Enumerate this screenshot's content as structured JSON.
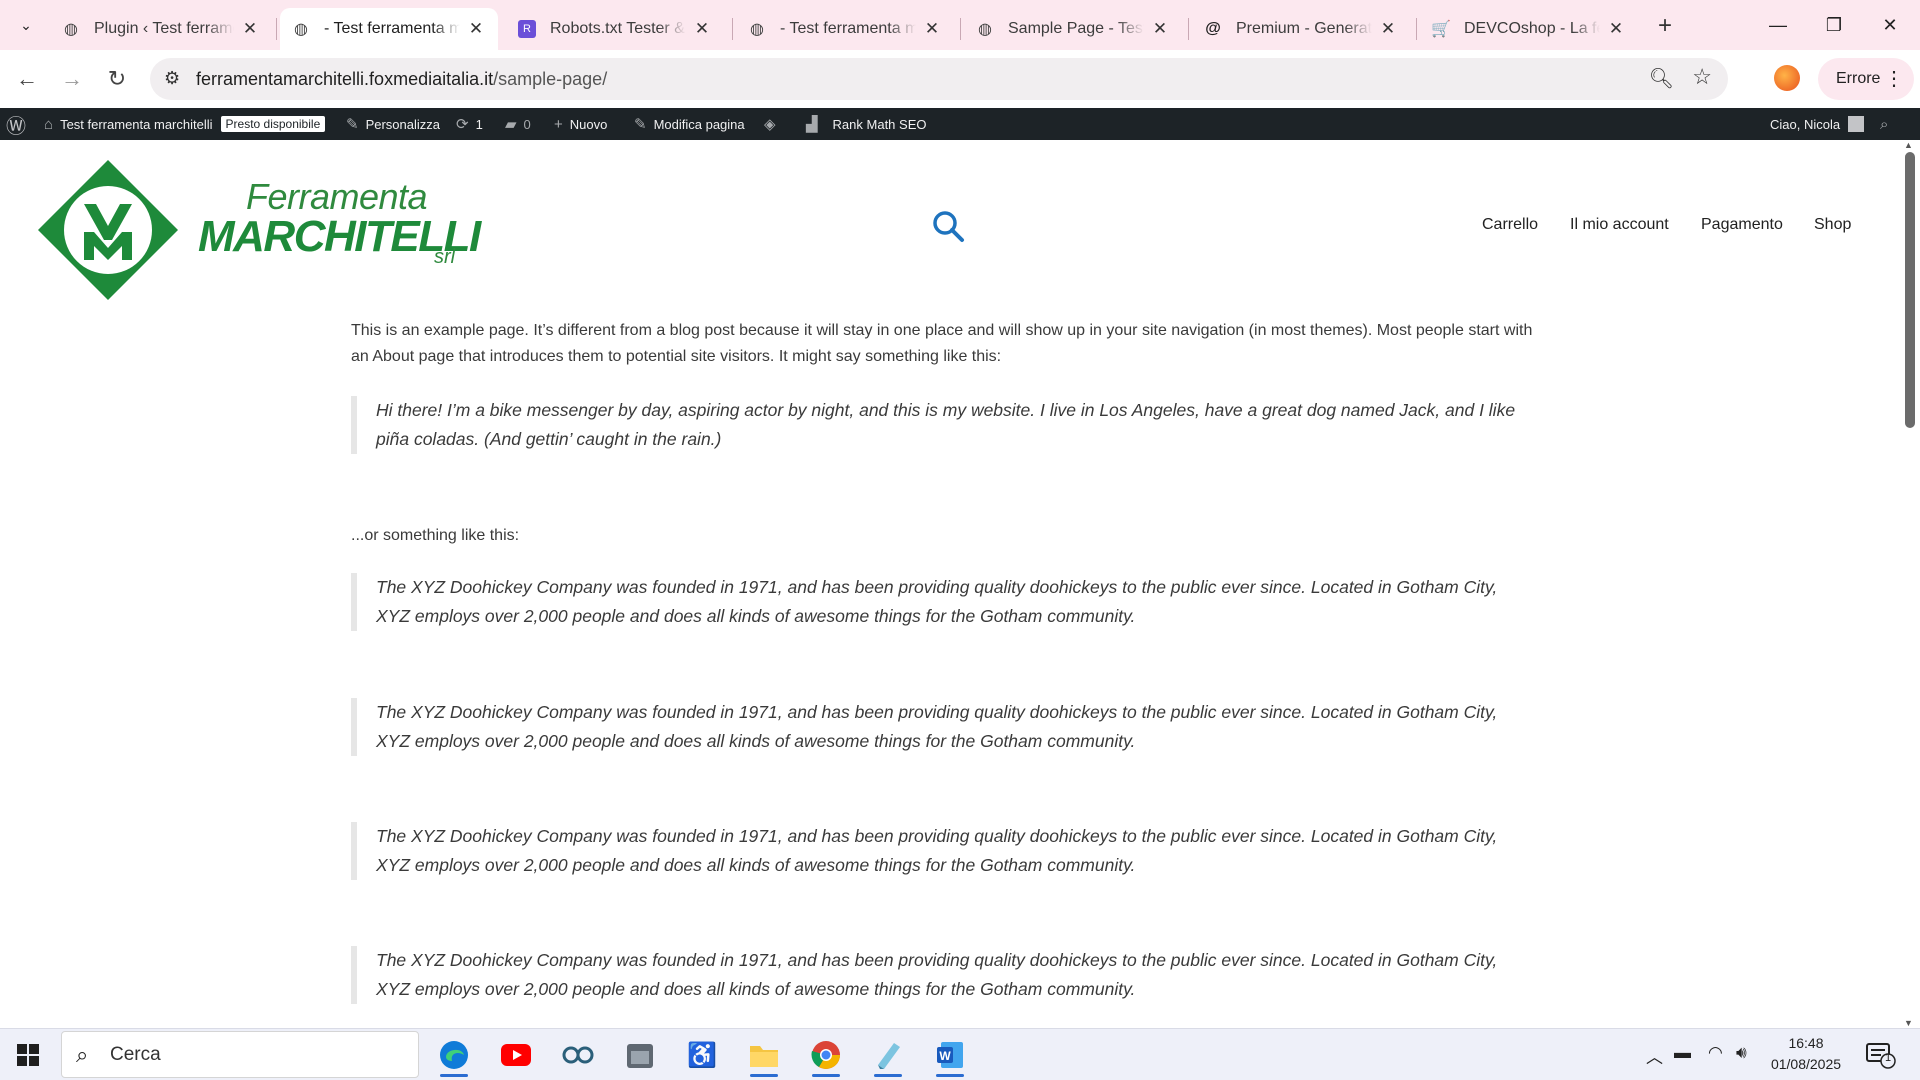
{
  "browser": {
    "tabs": [
      {
        "title": "Plugin ‹ Test ferramenta marchitelli",
        "icon": "globe-icon"
      },
      {
        "title": "- Test ferramenta marchitelli",
        "icon": "globe-icon",
        "active": true
      },
      {
        "title": "Robots.txt Tester & Validator",
        "icon": "robots-tester-icon"
      },
      {
        "title": "- Test ferramenta marchitelli",
        "icon": "globe-icon"
      },
      {
        "title": "Sample Page - Test ferramenta",
        "icon": "globe-icon"
      },
      {
        "title": "Premium - GeneratePress",
        "icon": "generatepress-icon"
      },
      {
        "title": "DEVCOshop - La ferramenta",
        "icon": "cart-icon"
      }
    ],
    "url_host": "ferramentamarchitelli.foxmediaitalia.it",
    "url_path": "/sample-page/",
    "profile_label": "Errore"
  },
  "admin_bar": {
    "site_name": "Test ferramenta marchitelli",
    "site_badge": "Presto disponibile",
    "customize": "Personalizza",
    "updates": "1",
    "comments": "0",
    "new": "Nuovo",
    "edit_page": "Modifica pagina",
    "rank_math": "Rank Math SEO",
    "greeting": "Ciao, Nicola"
  },
  "site": {
    "logo": {
      "line1": "Ferramenta",
      "line2": "MARCHITELLI",
      "suffix": "srl",
      "color": "#1e8a3a"
    },
    "menu": [
      "Carrello",
      "Il mio account",
      "Pagamento",
      "Shop"
    ],
    "accent": "#1e73be",
    "intro": "This is an example page. It’s different from a blog post because it will stay in one place and will show up in your site navigation (in most themes). Most people start with an About page that introduces them to potential site visitors. It might say something like this:",
    "quote1": "Hi there! I’m a bike messenger by day, aspiring actor by night, and this is my website. I live in Los Angeles, have a great dog named Jack, and I like piña coladas. (And gettin’ caught in the rain.)",
    "or_line": "...or something like this:",
    "quotes": [
      "The XYZ Doohickey Company was founded in 1971, and has been providing quality doohickeys to the public ever since. Located in Gotham City, XYZ employs over 2,000 people and does all kinds of awesome things for the Gotham community.",
      "The XYZ Doohickey Company was founded in 1971, and has been providing quality doohickeys to the public ever since. Located in Gotham City, XYZ employs over 2,000 people and does all kinds of awesome things for the Gotham community.",
      "The XYZ Doohickey Company was founded in 1971, and has been providing quality doohickeys to the public ever since. Located in Gotham City, XYZ employs over 2,000 people and does all kinds of awesome things for the Gotham community.",
      "The XYZ Doohickey Company was founded in 1971, and has been providing quality doohickeys to the public ever since. Located in Gotham City, XYZ employs over 2,000 people and does all kinds of awesome things for the Gotham community."
    ]
  },
  "taskbar": {
    "search_label": "Cerca",
    "apps": [
      "edge-icon",
      "youtube-icon",
      "arduino-icon",
      "calendar-app-icon",
      "accessibility-icon",
      "file-explorer-icon",
      "chrome-icon",
      "notes-app-icon",
      "word-icon"
    ],
    "time": "16:48",
    "date": "01/08/2025",
    "notifications": "1"
  }
}
